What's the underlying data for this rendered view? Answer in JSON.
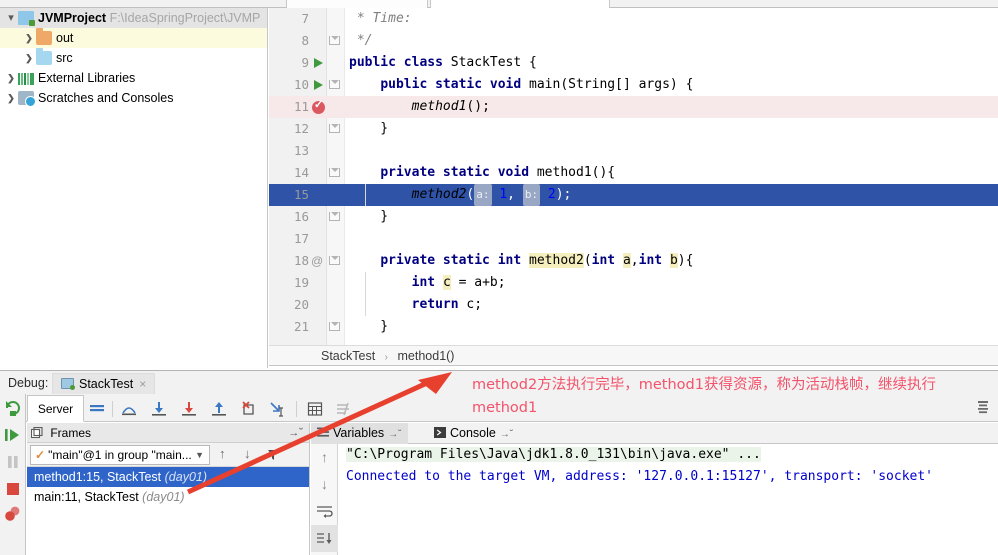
{
  "project": {
    "rows": [
      {
        "label": "JVMProject",
        "path": "F:\\IdeaSpringProject\\JVMP",
        "icon": "module-icon",
        "state": "expanded",
        "indent": 0,
        "selected": true
      },
      {
        "label": "out",
        "path": "",
        "icon": "folder-out-icon",
        "state": "collapsed",
        "indent": 1,
        "highlighted": true
      },
      {
        "label": "src",
        "path": "",
        "icon": "folder-src-icon",
        "state": "collapsed",
        "indent": 1
      },
      {
        "label": "External Libraries",
        "path": "",
        "icon": "libraries-icon",
        "state": "collapsed",
        "indent": 0
      },
      {
        "label": "Scratches and Consoles",
        "path": "",
        "icon": "scratches-icon",
        "state": "collapsed",
        "indent": 0
      }
    ]
  },
  "editor": {
    "lines": [
      {
        "num": "7",
        "gutter": "",
        "fold": "",
        "indent_guides": 0,
        "html": "<span class=\"cm\"> * Time:</span>"
      },
      {
        "num": "8",
        "gutter": "",
        "fold": "fold-end",
        "indent_guides": 0,
        "html": "<span class=\"cm\"> */</span>"
      },
      {
        "num": "9",
        "gutter": "run",
        "fold": "",
        "indent_guides": 0,
        "html": "<span class=\"kw\">public class</span> StackTest {"
      },
      {
        "num": "10",
        "gutter": "run",
        "fold": "fold-end",
        "indent_guides": 0,
        "html": "    <span class=\"kw\">public static void</span> main(String[] args) {"
      },
      {
        "num": "11",
        "gutter": "breakpoint",
        "fold": "",
        "indent_guides": 0,
        "state": "breakpoint-line",
        "html": "        <span class=\"mi\">method1</span>();"
      },
      {
        "num": "12",
        "gutter": "",
        "fold": "fold-end",
        "indent_guides": 0,
        "html": "    }"
      },
      {
        "num": "13",
        "gutter": "",
        "fold": "",
        "indent_guides": 0,
        "html": ""
      },
      {
        "num": "14",
        "gutter": "",
        "fold": "fold-end",
        "indent_guides": 0,
        "html": "    <span class=\"kw\">private static void</span> method1(){"
      },
      {
        "num": "15",
        "gutter": "",
        "fold": "",
        "indent_guides": 1,
        "state": "executing-line",
        "html": "        <span class=\"mi\">method2</span>(<span class=\"pnote\">a:</span> <span class=\"num\">1</span>, <span class=\"pnote\">b:</span> <span class=\"num\">2</span>);"
      },
      {
        "num": "16",
        "gutter": "",
        "fold": "fold-end",
        "indent_guides": 0,
        "html": "    }"
      },
      {
        "num": "17",
        "gutter": "",
        "fold": "",
        "indent_guides": 0,
        "html": ""
      },
      {
        "num": "18",
        "gutter": "at",
        "fold": "fold-end",
        "indent_guides": 0,
        "html": "    <span class=\"kw\">private static int</span> <span class=\"hlid\">method2</span>(<span class=\"kw\">int</span> <span class=\"hlid\">a</span>,<span class=\"kw\">int</span> <span class=\"hlid\">b</span>){"
      },
      {
        "num": "19",
        "gutter": "",
        "fold": "",
        "indent_guides": 1,
        "html": "        <span class=\"kw\">int</span> <span class=\"hlid\">c</span> = a+b;"
      },
      {
        "num": "20",
        "gutter": "",
        "fold": "",
        "indent_guides": 1,
        "html": "        <span class=\"kw\">return</span> c;"
      },
      {
        "num": "21",
        "gutter": "",
        "fold": "fold-end",
        "indent_guides": 0,
        "html": "    }"
      }
    ]
  },
  "breadcrumb": {
    "class": "StackTest",
    "separator": "›",
    "method": "method1()"
  },
  "debug": {
    "label": "Debug:",
    "tab_title": "StackTest",
    "close_label": "×",
    "server_tab": "Server",
    "toolbar_icons": [
      "show-execution-point-icon",
      "step-over-icon",
      "step-into-icon",
      "force-step-into-icon",
      "step-out-icon",
      "drop-frame-icon",
      "run-to-cursor-icon",
      "evaluate-expression-icon",
      "mute-breakpoints-icon"
    ],
    "side_icons": [
      "rerun-icon",
      "resume-program-icon",
      "pause-program-icon",
      "stop-icon",
      "view-breakpoints-icon"
    ],
    "settings_icon": "layout-settings-icon"
  },
  "frames": {
    "title": "Frames",
    "collapse_icon": "hide-icon",
    "thread": "\"main\"@1 in group \"main...",
    "thread_check_icon": "thread-running-icon",
    "chevron_icon": "chevron-down-icon",
    "up_icon": "move-up-icon",
    "down_icon": "move-down-icon",
    "filter_icon": "filter-icon",
    "rows": [
      {
        "text": "method1:15, StackTest",
        "location": "(day01)",
        "selected": true
      },
      {
        "text": "main:11, StackTest",
        "location": "(day01)",
        "selected": false
      }
    ]
  },
  "variables_tabs": [
    {
      "label": "Variables",
      "icon": "variables-icon",
      "active": true,
      "pin": "→˘"
    },
    {
      "label": "Console",
      "icon": "console-icon",
      "active": false,
      "pin": "→˘"
    }
  ],
  "console": {
    "side_icons": [
      "scroll-up-icon",
      "scroll-down-icon",
      "soft-wrap-icon",
      "scroll-to-end-icon"
    ],
    "lines": [
      {
        "text": "\"C:\\Program Files\\Java\\jdk1.8.0_131\\bin\\java.exe\" ...",
        "style": "cmd"
      },
      {
        "text": "Connected to the target VM, address: '127.0.0.1:15127', transport: 'socket'",
        "style": "info"
      }
    ]
  },
  "annotation": {
    "line1": "method2方法执行完毕，method1获得资源，称为活动栈帧，继续执行",
    "line2": "method1",
    "color": "#f4526a",
    "arrow_icon": "red-arrow-icon"
  },
  "colors": {
    "execution_line": "#2f53a7",
    "breakpoint_line": "#f7e9e9",
    "frame_selected": "#2f65c8",
    "annotation_red": "#f4526a",
    "tree_highlight": "#fcfbdd"
  }
}
